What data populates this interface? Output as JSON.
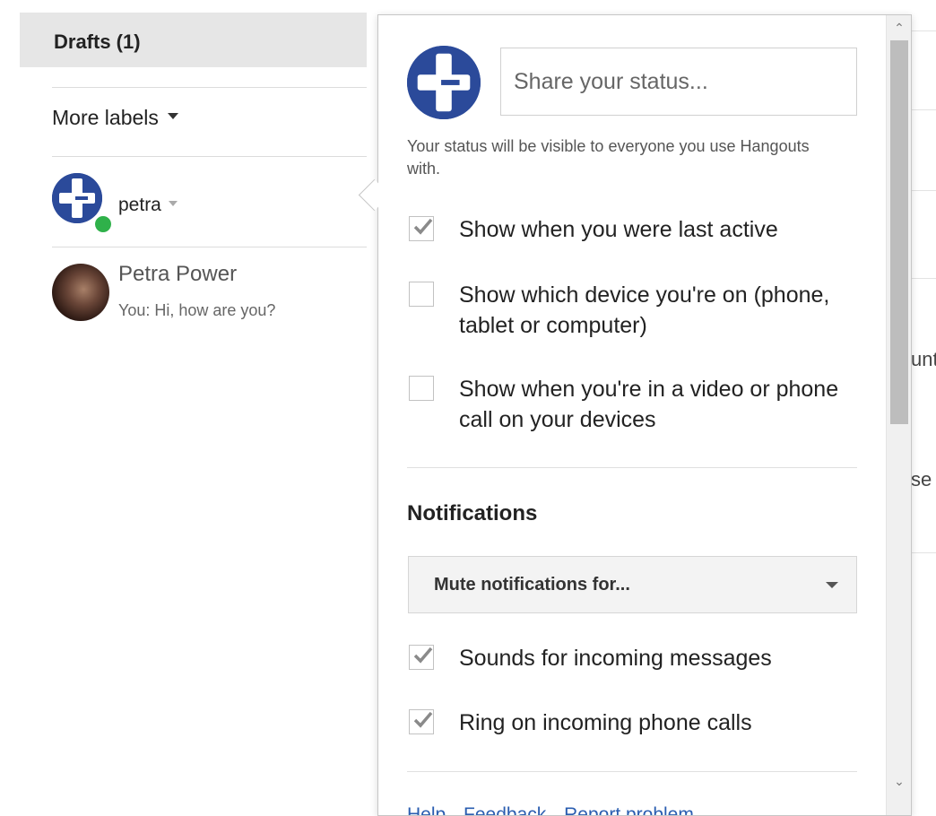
{
  "sidebar": {
    "drafts_label": "Drafts (1)",
    "more_labels": "More labels",
    "me_name": "petra",
    "contacts": [
      {
        "name": "Petra Power",
        "last_message": "You: Hi, how are you?"
      }
    ]
  },
  "background": {
    "fragment_1": "unt",
    "fragment_2": "se"
  },
  "popup": {
    "status_placeholder": "Share your status...",
    "status_note": "Your status will be visible to everyone you use Hangouts with.",
    "options": [
      {
        "label": "Show when you were last active",
        "checked": true
      },
      {
        "label": "Show which device you're on (phone, tablet or computer)",
        "checked": false
      },
      {
        "label": "Show when you're in a video or phone call on your devices",
        "checked": false
      }
    ],
    "notifications_title": "Notifications",
    "mute_select_label": "Mute notifications for...",
    "notification_options": [
      {
        "label": "Sounds for incoming messages",
        "checked": true
      },
      {
        "label": "Ring on incoming phone calls",
        "checked": true
      }
    ],
    "footer_links": [
      "Help",
      "Feedback",
      "Report problem"
    ]
  },
  "colors": {
    "gplus_blue": "#2b4a9a",
    "online_green": "#2fb14a",
    "link_blue": "#2a5db0"
  }
}
